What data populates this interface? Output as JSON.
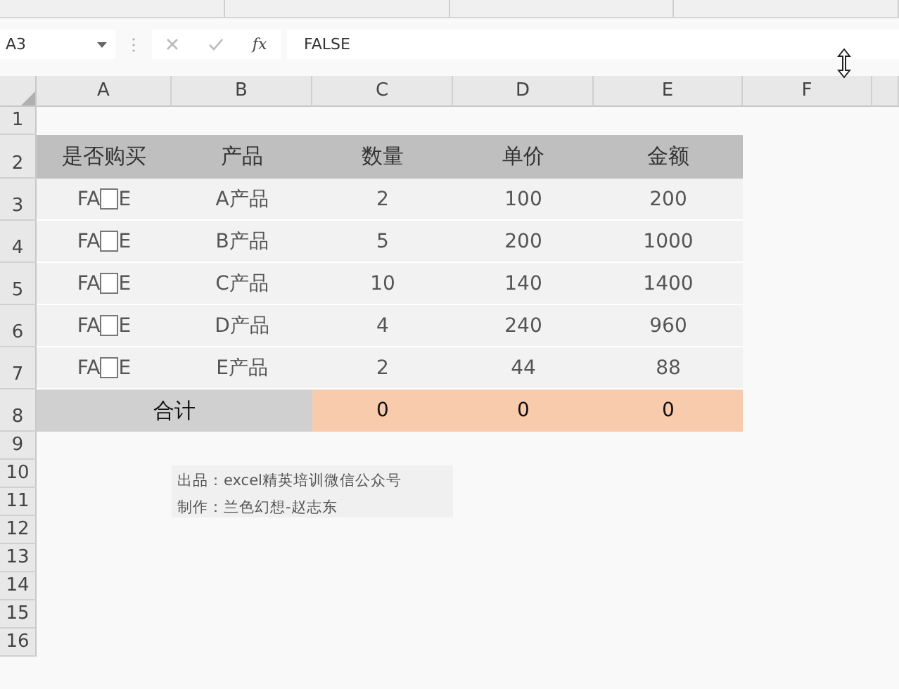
{
  "name_box": "A3",
  "function_label": "fx",
  "formula": "FALSE",
  "columns": [
    "A",
    "B",
    "C",
    "D",
    "E",
    "F"
  ],
  "row_numbers": [
    "1",
    "2",
    "3",
    "4",
    "5",
    "6",
    "7",
    "8",
    "9",
    "10",
    "11",
    "12",
    "13",
    "14",
    "15",
    "16"
  ],
  "table": {
    "header": [
      "是否购买",
      "产品",
      "数量",
      "单价",
      "金额"
    ],
    "rows": [
      {
        "purchased_left": "FA",
        "purchased_right": "E",
        "checked": false,
        "product": "A产品",
        "quantity": "2",
        "price": "100",
        "amount": "200"
      },
      {
        "purchased_left": "FA",
        "purchased_right": "E",
        "checked": false,
        "product": "B产品",
        "quantity": "5",
        "price": "200",
        "amount": "1000"
      },
      {
        "purchased_left": "FA",
        "purchased_right": "E",
        "checked": false,
        "product": "C产品",
        "quantity": "10",
        "price": "140",
        "amount": "1400"
      },
      {
        "purchased_left": "FA",
        "purchased_right": "E",
        "checked": false,
        "product": "D产品",
        "quantity": "4",
        "price": "240",
        "amount": "960"
      },
      {
        "purchased_left": "FA",
        "purchased_right": "E",
        "checked": false,
        "product": "E产品",
        "quantity": "2",
        "price": "44",
        "amount": "88"
      }
    ],
    "total": {
      "label": "合计",
      "values": [
        "0",
        "0",
        "0"
      ]
    }
  },
  "credits": [
    "出品：excel精英培训微信公众号",
    "制作：兰色幻想-赵志东"
  ]
}
